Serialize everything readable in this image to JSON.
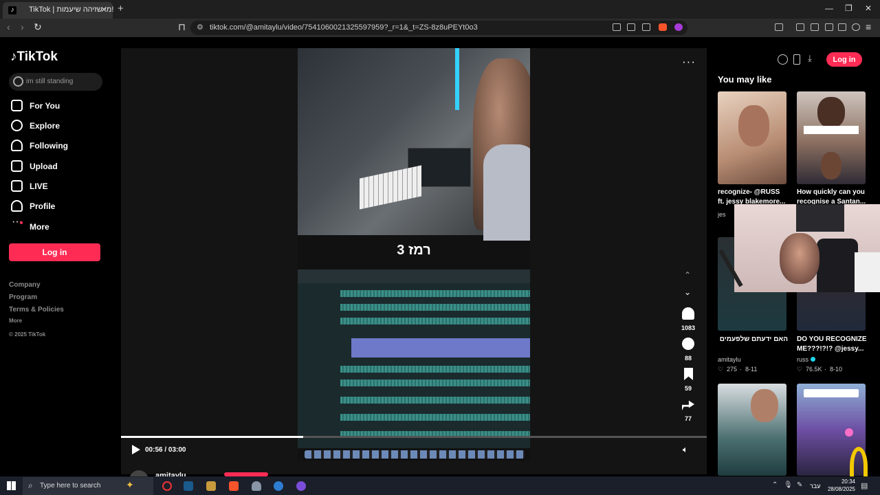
{
  "browser": {
    "tab_title": "TikTok | מי שזיהה שיעמות!",
    "new_tab": "+",
    "url": "tiktok.com/@amitaylu/video/7541060021325597959?_r=1&_t=ZS-8z8uPEYt0o3",
    "window_controls": [
      "—",
      "❐",
      "✕"
    ]
  },
  "sidebar": {
    "logo": "TikTok",
    "search_placeholder": "im still standing",
    "nav": [
      {
        "label": "For You",
        "icon": "home-icon"
      },
      {
        "label": "Explore",
        "icon": "compass-icon"
      },
      {
        "label": "Following",
        "icon": "following-icon"
      },
      {
        "label": "Upload",
        "icon": "upload-icon"
      },
      {
        "label": "LIVE",
        "icon": "live-icon"
      },
      {
        "label": "Profile",
        "icon": "profile-icon"
      },
      {
        "label": "More",
        "icon": "more-dots-icon"
      }
    ],
    "login": "Log in",
    "footer": {
      "company": "Company",
      "program": "Program",
      "terms": "Terms & Policies",
      "more": "More",
      "copyright": "© 2025 TikTok"
    }
  },
  "video": {
    "overlay_title": "רמז 3",
    "current_time": "00:56",
    "separator": " / ",
    "duration": "03:00",
    "progress": 0.311,
    "author": "amitaylu"
  },
  "actions": {
    "likes": "1083",
    "comments": "88",
    "saves": "59",
    "shares": "77"
  },
  "right": {
    "login": "Log in",
    "heading": "You may like",
    "cards": [
      {
        "caption": "recognize- @RUSS ft. jessy blakemore...",
        "author": "jes"
      },
      {
        "caption": "How quickly can you recognise a Santan..."
      },
      {
        "caption": "האם ידעתם שלפעמים ההפרש בין ההקלטה ...",
        "author": "amitaylu",
        "likes": "275",
        "date": "8-11"
      },
      {
        "caption": "DO YOU RECOGNIZE ME???!?!? @jessy...",
        "author": "russ",
        "likes": "76.5K",
        "date": "8-10"
      }
    ]
  },
  "taskbar": {
    "search_placeholder": "Type here to search",
    "lang": "עבר",
    "time": "20:34",
    "date": "28/08/2025"
  },
  "colors": {
    "accent": "#fe2c55",
    "background": "#000000",
    "stage": "#141414"
  }
}
